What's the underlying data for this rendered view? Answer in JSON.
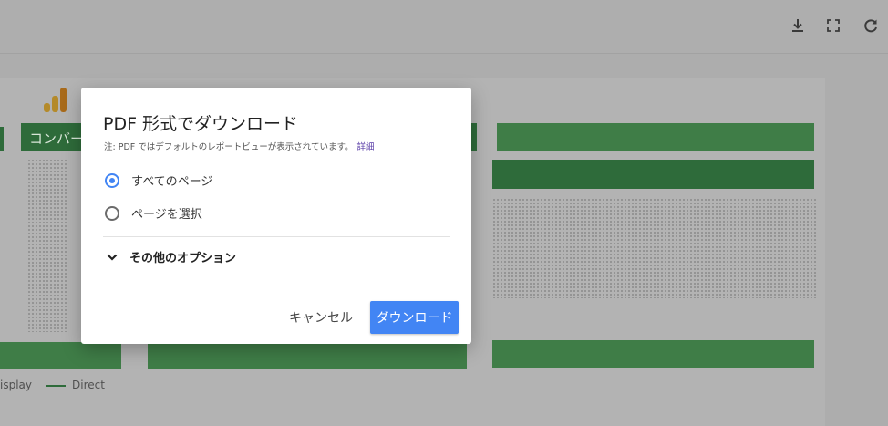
{
  "toolbar": {
    "icons": [
      "download-icon",
      "fullscreen-icon",
      "refresh-icon"
    ]
  },
  "background": {
    "section_label": "コンバー",
    "legend": [
      "isplay",
      "Direct"
    ],
    "logo_colors": [
      "#f4b400",
      "#e37400"
    ]
  },
  "dialog": {
    "title": "PDF 形式でダウンロード",
    "note": "注: PDF ではデフォルトのレポートビューが表示されています。",
    "note_link": "詳細",
    "options": [
      {
        "label": "すべてのページ",
        "selected": true
      },
      {
        "label": "ページを選択",
        "selected": false
      }
    ],
    "more_options_label": "その他のオプション",
    "cancel_label": "キャンセル",
    "download_label": "ダウンロード"
  },
  "colors": {
    "accent": "#4285f4",
    "link": "#5b3fa8",
    "report_green": "#2e6b3a"
  }
}
